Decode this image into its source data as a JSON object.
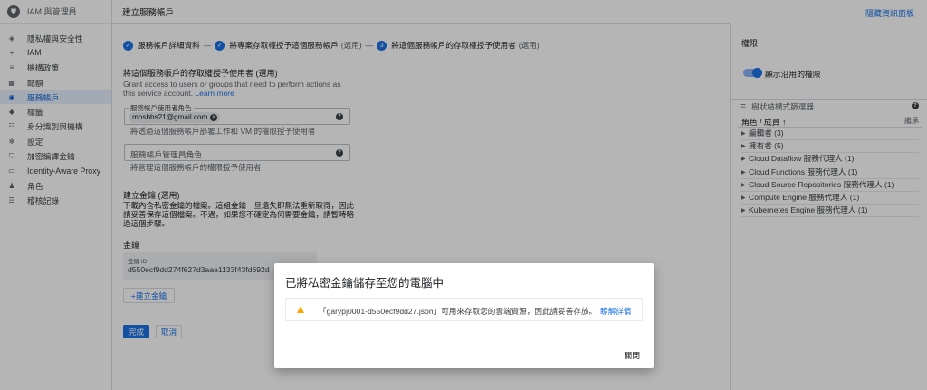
{
  "sidebar": {
    "header": "IAM 與管理員",
    "items": [
      {
        "label": "隱私權與安全性",
        "icon": "shield-outline-icon"
      },
      {
        "label": "IAM",
        "icon": "person-add-icon"
      },
      {
        "label": "機構政策",
        "icon": "list-icon"
      },
      {
        "label": "配額",
        "icon": "grid-icon"
      },
      {
        "label": "服務帳戶",
        "icon": "service-account-icon",
        "active": true
      },
      {
        "label": "標籤",
        "icon": "label-icon"
      },
      {
        "label": "身分識別與機構",
        "icon": "org-icon"
      },
      {
        "label": "設定",
        "icon": "gear-icon"
      },
      {
        "label": "加密編譯金鑰",
        "icon": "key-shield-icon"
      },
      {
        "label": "Identity-Aware Proxy",
        "icon": "iap-icon"
      },
      {
        "label": "角色",
        "icon": "role-icon"
      },
      {
        "label": "稽核記錄",
        "icon": "list-lines-icon"
      }
    ]
  },
  "main": {
    "title": "建立服務帳戶",
    "hide_panel": "隱藏資訊面板",
    "steps": {
      "s1": "服務帳戶詳細資料",
      "s2": "將專案存取權授予這個服務帳戶",
      "s2_opt": "(選用)",
      "s3_num": "3",
      "s3": "將這個服務帳戶的存取權授予使用者",
      "s3_opt": "(選用)",
      "dash": "—"
    },
    "section_title": "將這個服務帳戶的存取權授予使用者 (選用)",
    "section_desc": "Grant access to users or groups that need to perform actions as this service account.",
    "learn_more": "Learn more",
    "user_role": {
      "label": "服務帳戶使用者角色",
      "chip": "mosbbs21@gmail.com",
      "hint": "將透過這個服務帳戶部署工作和 VM 的權限授予使用者"
    },
    "admin_role": {
      "placeholder": "服務帳戶管理員角色",
      "hint": "將管理這個服務帳戶的權限授予使用者"
    },
    "key_section": {
      "title": "建立金鑰 (選用)",
      "desc": "下載內含私密金鑰的檔案。這組金鑰一旦遺失即無法重新取得，因此請妥善保存這個檔案。不過，如果您不確定為何需要金鑰，請暫時略過這個步驟。",
      "label": "金鑰",
      "id_label": "金鑰 ID",
      "id_value": "d550ecf9dd274f627d3aae1133f43fd692d"
    },
    "add_key": "+建立金鑰",
    "done": "完成",
    "cancel": "取消"
  },
  "panel": {
    "title": "權限",
    "toggle_label": "顯示沿用的權限",
    "filter": "樹狀結構式篩選器",
    "col_role": "角色 / 成員",
    "col_inherit": "繼承",
    "rows": [
      "編輯者 (3)",
      "擁有者 (5)",
      "Cloud Dataflow 服務代理人 (1)",
      "Cloud Functions 服務代理人 (1)",
      "Cloud Source Repositories 服務代理人 (1)",
      "Compute Engine 服務代理人 (1)",
      "Kubernetes Engine 服務代理人 (1)"
    ]
  },
  "dialog": {
    "title": "已將私密金鑰儲存至您的電腦中",
    "message": "「garypj0001-d550ecf9dd27.json」可用來存取您的雲端資源，因此請妥善存放。",
    "link": "瞭解詳情",
    "close": "關閉"
  }
}
